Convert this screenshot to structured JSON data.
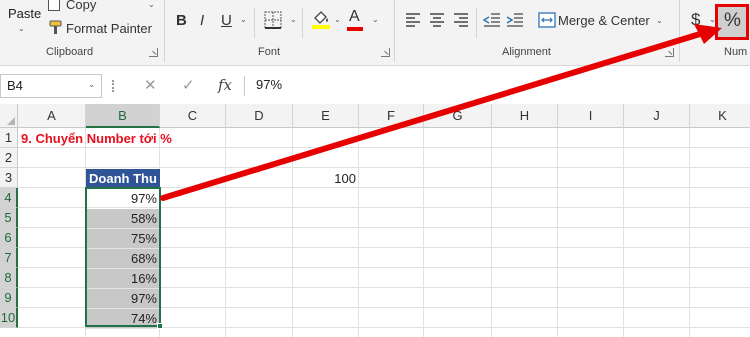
{
  "ribbon": {
    "paste_label": "Paste",
    "copy_label": "Copy",
    "format_painter_label": "Format Painter",
    "clipboard_group_label": "Clipboard",
    "font_bold": "B",
    "font_italic": "I",
    "font_underline": "U",
    "font_color_letter": "A",
    "font_group_label": "Font",
    "merge_center_label": "Merge & Center",
    "alignment_group_label": "Alignment",
    "currency_symbol": "$",
    "percent_symbol": "%",
    "number_group_label": "Num",
    "highlight_color": "#e60000",
    "fill_color": "#ffff00",
    "font_color": "#e60000"
  },
  "formula_bar": {
    "name_box": "B4",
    "cancel_glyph": "✕",
    "enter_glyph": "✓",
    "fx_label": "fx",
    "formula_value": "97%"
  },
  "grid": {
    "columns": [
      "A",
      "B",
      "C",
      "D",
      "E",
      "F",
      "G",
      "H",
      "I",
      "J",
      "K"
    ],
    "rows": [
      "1",
      "2",
      "3",
      "4",
      "5",
      "6",
      "7",
      "8",
      "9",
      "10"
    ],
    "title_cell": "9. Chuyển Number tới %",
    "header_cell": "Doanh Thu",
    "e3_value": "100",
    "b_values": [
      "97%",
      "58%",
      "75%",
      "68%",
      "16%",
      "97%",
      "74%"
    ],
    "header_fill": "#2f5597",
    "selection_fill": "#c8c8c8",
    "title_color": "#e6101d"
  },
  "annotation": {
    "arrow_color": "#e60000"
  }
}
